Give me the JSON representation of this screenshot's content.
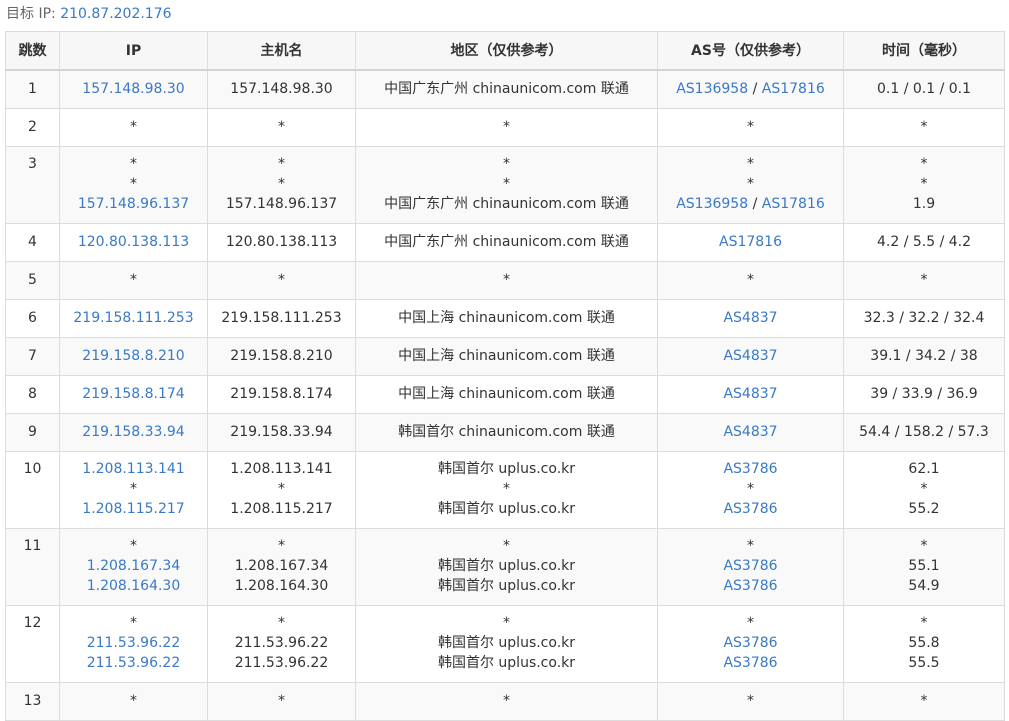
{
  "target": {
    "label": "目标 IP:",
    "ip": "210.87.202.176"
  },
  "headers": [
    "跳数",
    "IP",
    "主机名",
    "地区（仅供参考）",
    "AS号（仅供参考）",
    "时间（毫秒）"
  ],
  "hops": [
    {
      "hop": "1",
      "lines": [
        {
          "ip": "157.148.98.30",
          "host": "157.148.98.30",
          "region": "中国广东广州 chinaunicom.com 联通",
          "as": [
            "AS136958",
            "AS17816"
          ],
          "time": "0.1 / 0.1 / 0.1"
        }
      ]
    },
    {
      "hop": "2",
      "lines": [
        {
          "ip": "*",
          "host": "*",
          "region": "*",
          "as": [
            "*"
          ],
          "time": "*"
        }
      ]
    },
    {
      "hop": "3",
      "lines": [
        {
          "ip": "*",
          "host": "*",
          "region": "*",
          "as": [
            "*"
          ],
          "time": "*"
        },
        {
          "ip": "*",
          "host": "*",
          "region": "*",
          "as": [
            "*"
          ],
          "time": "*"
        },
        {
          "ip": "157.148.96.137",
          "host": "157.148.96.137",
          "region": "中国广东广州 chinaunicom.com 联通",
          "as": [
            "AS136958",
            "AS17816"
          ],
          "time": "1.9"
        }
      ]
    },
    {
      "hop": "4",
      "lines": [
        {
          "ip": "120.80.138.113",
          "host": "120.80.138.113",
          "region": "中国广东广州 chinaunicom.com 联通",
          "as": [
            "AS17816"
          ],
          "time": "4.2 / 5.5 / 4.2"
        }
      ]
    },
    {
      "hop": "5",
      "lines": [
        {
          "ip": "*",
          "host": "*",
          "region": "*",
          "as": [
            "*"
          ],
          "time": "*"
        }
      ]
    },
    {
      "hop": "6",
      "lines": [
        {
          "ip": "219.158.111.253",
          "host": "219.158.111.253",
          "region": "中国上海 chinaunicom.com 联通",
          "as": [
            "AS4837"
          ],
          "time": "32.3 / 32.2 / 32.4"
        }
      ]
    },
    {
      "hop": "7",
      "lines": [
        {
          "ip": "219.158.8.210",
          "host": "219.158.8.210",
          "region": "中国上海 chinaunicom.com 联通",
          "as": [
            "AS4837"
          ],
          "time": "39.1 / 34.2 / 38"
        }
      ]
    },
    {
      "hop": "8",
      "lines": [
        {
          "ip": "219.158.8.174",
          "host": "219.158.8.174",
          "region": "中国上海 chinaunicom.com 联通",
          "as": [
            "AS4837"
          ],
          "time": "39 / 33.9 / 36.9"
        }
      ]
    },
    {
      "hop": "9",
      "lines": [
        {
          "ip": "219.158.33.94",
          "host": "219.158.33.94",
          "region": "韩国首尔 chinaunicom.com 联通",
          "as": [
            "AS4837"
          ],
          "time": "54.4 / 158.2 / 57.3"
        }
      ]
    },
    {
      "hop": "10",
      "lines": [
        {
          "ip": "1.208.113.141",
          "host": "1.208.113.141",
          "region": "韩国首尔 uplus.co.kr",
          "as": [
            "AS3786"
          ],
          "time": "62.1"
        },
        {
          "ip": "*",
          "host": "*",
          "region": "*",
          "as": [
            "*"
          ],
          "time": "*"
        },
        {
          "ip": "1.208.115.217",
          "host": "1.208.115.217",
          "region": "韩国首尔 uplus.co.kr",
          "as": [
            "AS3786"
          ],
          "time": "55.2"
        }
      ]
    },
    {
      "hop": "11",
      "lines": [
        {
          "ip": "*",
          "host": "*",
          "region": "*",
          "as": [
            "*"
          ],
          "time": "*"
        },
        {
          "ip": "1.208.167.34",
          "host": "1.208.167.34",
          "region": "韩国首尔 uplus.co.kr",
          "as": [
            "AS3786"
          ],
          "time": "55.1"
        },
        {
          "ip": "1.208.164.30",
          "host": "1.208.164.30",
          "region": "韩国首尔 uplus.co.kr",
          "as": [
            "AS3786"
          ],
          "time": "54.9"
        }
      ]
    },
    {
      "hop": "12",
      "lines": [
        {
          "ip": "*",
          "host": "*",
          "region": "*",
          "as": [
            "*"
          ],
          "time": "*"
        },
        {
          "ip": "211.53.96.22",
          "host": "211.53.96.22",
          "region": "韩国首尔 uplus.co.kr",
          "as": [
            "AS3786"
          ],
          "time": "55.8"
        },
        {
          "ip": "211.53.96.22",
          "host": "211.53.96.22",
          "region": "韩国首尔 uplus.co.kr",
          "as": [
            "AS3786"
          ],
          "time": "55.5"
        }
      ]
    },
    {
      "hop": "13",
      "lines": [
        {
          "ip": "*",
          "host": "*",
          "region": "*",
          "as": [
            "*"
          ],
          "time": "*"
        }
      ]
    }
  ],
  "colors": {
    "link": "#3a79c6",
    "border": "#dcdcdc",
    "row_alt": "#f9f9f9",
    "header_bg": "#f7f7f7"
  }
}
